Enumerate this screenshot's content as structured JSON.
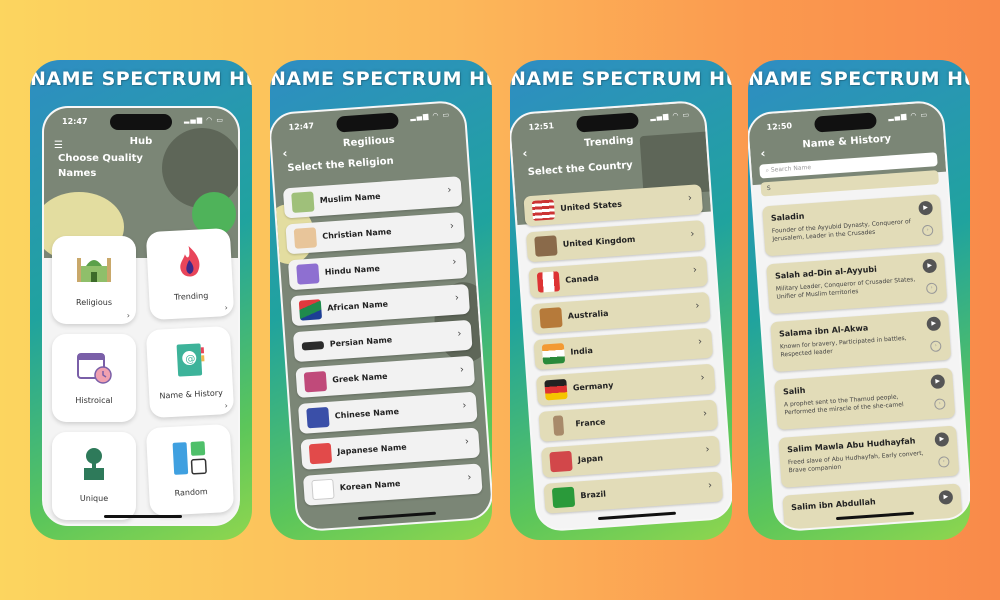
{
  "brand_title": "NAME SPECTRUM HUB",
  "status_icons": "▂▄▆ ◠ ▭",
  "screen1": {
    "time": "12:47",
    "title": "Hub",
    "subtitle_line1": "Choose Quality",
    "subtitle_line2": "Names",
    "tiles": [
      {
        "label": "Religious",
        "icon": "mosque-icon"
      },
      {
        "label": "Trending",
        "icon": "flame-icon"
      },
      {
        "label": "Histroical",
        "icon": "calendar-clock-icon"
      },
      {
        "label": "Name & History",
        "icon": "address-book-icon"
      },
      {
        "label": "Unique",
        "icon": "tree-box-icon"
      },
      {
        "label": "Random",
        "icon": "squares-grid-icon"
      }
    ]
  },
  "screen2": {
    "time": "12:47",
    "title": "Regilious",
    "subtitle": "Select the Religion",
    "rows": [
      {
        "label": "Muslim Name",
        "icon": "mosque-icon"
      },
      {
        "label": "Christian Name",
        "icon": "church-icon"
      },
      {
        "label": "Hindu Name",
        "icon": "swastika-icon"
      },
      {
        "label": "African Name",
        "icon": "south-africa-flag-icon"
      },
      {
        "label": "Persian Name",
        "icon": "faravahar-icon"
      },
      {
        "label": "Greek Name",
        "icon": "greek-helmet-icon"
      },
      {
        "label": "Chinese Name",
        "icon": "lion-mask-icon"
      },
      {
        "label": "Japanese Name",
        "icon": "torii-gate-icon"
      },
      {
        "label": "Korean Name",
        "icon": "korea-flag-icon"
      }
    ]
  },
  "screen3": {
    "time": "12:51",
    "title": "Trending",
    "subtitle": "Select the Country",
    "rows": [
      {
        "label": "United States",
        "icon": "us-flag-icon"
      },
      {
        "label": "United Kingdom",
        "icon": "tower-bridge-icon"
      },
      {
        "label": "Canada",
        "icon": "canada-flag-icon"
      },
      {
        "label": "Australia",
        "icon": "kangaroo-icon"
      },
      {
        "label": "India",
        "icon": "india-flag-icon"
      },
      {
        "label": "Germany",
        "icon": "germany-flag-icon"
      },
      {
        "label": "France",
        "icon": "eiffel-tower-icon"
      },
      {
        "label": "Japan",
        "icon": "pagoda-icon"
      },
      {
        "label": "Brazil",
        "icon": "brazil-flag-icon"
      }
    ]
  },
  "screen4": {
    "time": "12:50",
    "title": "Name & History",
    "search_placeholder": "Search Name",
    "search_value": "S",
    "rows": [
      {
        "name": "Saladin",
        "desc": "Founder of the Ayyubid Dynasty, Conqueror of Jerusalem, Leader in the Crusades"
      },
      {
        "name": "Salah ad-Din al-Ayyubi",
        "desc": "Military Leader, Conqueror of Crusader States, Unifier of Muslim territories"
      },
      {
        "name": "Salama ibn Al-Akwa",
        "desc": "Known for bravery, Participated in battles, Respected leader"
      },
      {
        "name": "Salih",
        "desc": "A prophet sent to the Thamud people, Performed the miracle of the she-camel"
      },
      {
        "name": "Salim Mawla Abu Hudhayfah",
        "desc": "Freed slave of Abu Hudhayfah, Early convert, Brave companion"
      },
      {
        "name": "Salim ibn Abdullah",
        "desc": ""
      }
    ]
  }
}
